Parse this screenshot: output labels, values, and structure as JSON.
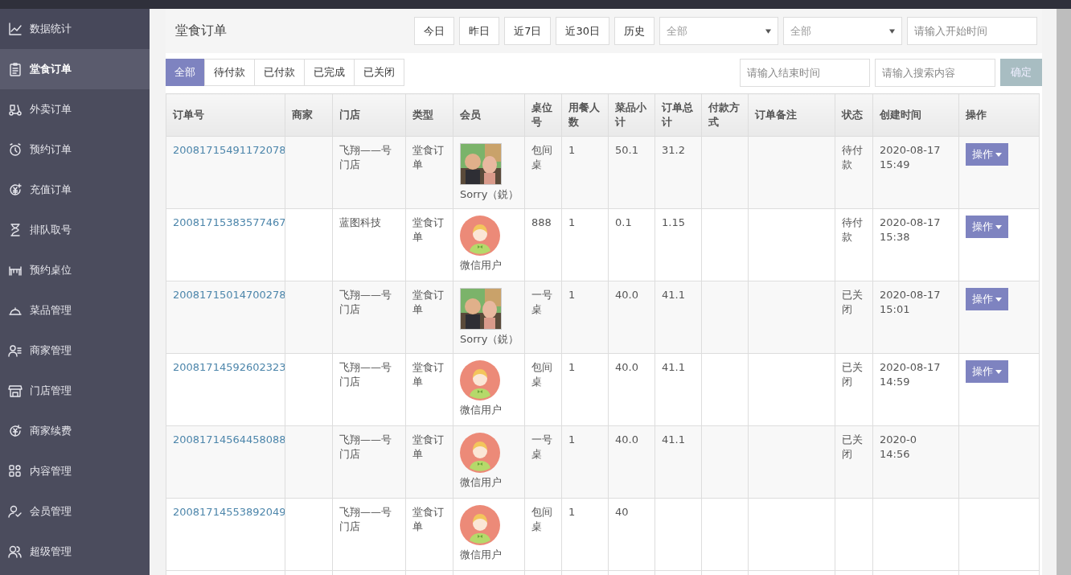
{
  "sidebar": {
    "items": [
      {
        "label": "数据统计",
        "selected": false
      },
      {
        "label": "堂食订单",
        "selected": true
      },
      {
        "label": "外卖订单",
        "selected": false
      },
      {
        "label": "预约订单",
        "selected": false
      },
      {
        "label": "充值订单",
        "selected": false
      },
      {
        "label": "排队取号",
        "selected": false
      },
      {
        "label": "预约桌位",
        "selected": false
      },
      {
        "label": "菜品管理",
        "selected": false
      },
      {
        "label": "商家管理",
        "selected": false
      },
      {
        "label": "门店管理",
        "selected": false
      },
      {
        "label": "商家续费",
        "selected": false
      },
      {
        "label": "内容管理",
        "selected": false
      },
      {
        "label": "会员管理",
        "selected": false
      },
      {
        "label": "超级管理",
        "selected": false
      }
    ]
  },
  "page_title": "堂食订单",
  "date_buttons": [
    "今日",
    "昨日",
    "近7日",
    "近30日",
    "历史"
  ],
  "selects": [
    {
      "value": "全部"
    },
    {
      "value": "全部"
    }
  ],
  "start_time": {
    "placeholder": "请输入开始时间"
  },
  "status_tabs": [
    {
      "label": "全部",
      "selected": true
    },
    {
      "label": "待付款",
      "selected": false
    },
    {
      "label": "已付款",
      "selected": false
    },
    {
      "label": "已完成",
      "selected": false
    },
    {
      "label": "已关闭",
      "selected": false
    }
  ],
  "end_time": {
    "placeholder": "请输入结束时间"
  },
  "search": {
    "placeholder": "请输入搜索内容"
  },
  "confirm_button": "确定",
  "table": {
    "columns": [
      "订单号",
      "商家",
      "门店",
      "类型",
      "会员",
      "桌位号",
      "用餐人数",
      "菜品小计",
      "订单总计",
      "付款方式",
      "订单备注",
      "状态",
      "创建时间",
      "操作"
    ],
    "rows": [
      {
        "order_no": "20081715491172078",
        "store": "飞翔——号门店",
        "type": "堂食订单",
        "member": {
          "kind": "picture",
          "name": "Sorry（鋭）"
        },
        "table_no": "包间桌",
        "diners": "1",
        "subtotal": "50.1",
        "total": "31.2",
        "status": "待付款",
        "created": "2020-08-17 15:49",
        "action": "操作"
      },
      {
        "order_no": "20081715383577467",
        "store": "蓝图科技",
        "type": "堂食订单",
        "member": {
          "kind": "default",
          "name": "微信用户"
        },
        "table_no": "888",
        "diners": "1",
        "subtotal": "0.1",
        "total": "1.15",
        "status": "待付款",
        "created": "2020-08-17 15:38",
        "action": "操作"
      },
      {
        "order_no": "20081715014700278",
        "store": "飞翔——号门店",
        "type": "堂食订单",
        "member": {
          "kind": "picture",
          "name": "Sorry（鋭）"
        },
        "table_no": "一号桌",
        "diners": "1",
        "subtotal": "40.0",
        "total": "41.1",
        "status": "已关闭",
        "created": "2020-08-17 15:01",
        "action": "操作"
      },
      {
        "order_no": "20081714592602323",
        "store": "飞翔——号门店",
        "type": "堂食订单",
        "member": {
          "kind": "default",
          "name": "微信用户"
        },
        "table_no": "包间桌",
        "diners": "1",
        "subtotal": "40.0",
        "total": "41.1",
        "status": "已关闭",
        "created": "2020-08-17 14:59",
        "action": "操作"
      },
      {
        "order_no": "20081714564458088",
        "store": "飞翔——号门店",
        "type": "堂食订单",
        "member": {
          "kind": "default",
          "name": "微信用户"
        },
        "table_no": "一号桌",
        "diners": "1",
        "subtotal": "40.0",
        "total": "41.1",
        "status": "已关闭",
        "created": "2020-0\n14:56"
      },
      {
        "order_no": "20081714553892049",
        "store": "飞翔——号门店",
        "type": "堂食订单",
        "member": {
          "kind": "default",
          "name": "微信用户"
        },
        "table_no": "包间桌",
        "diners": "1",
        "subtotal": "40"
      }
    ]
  }
}
